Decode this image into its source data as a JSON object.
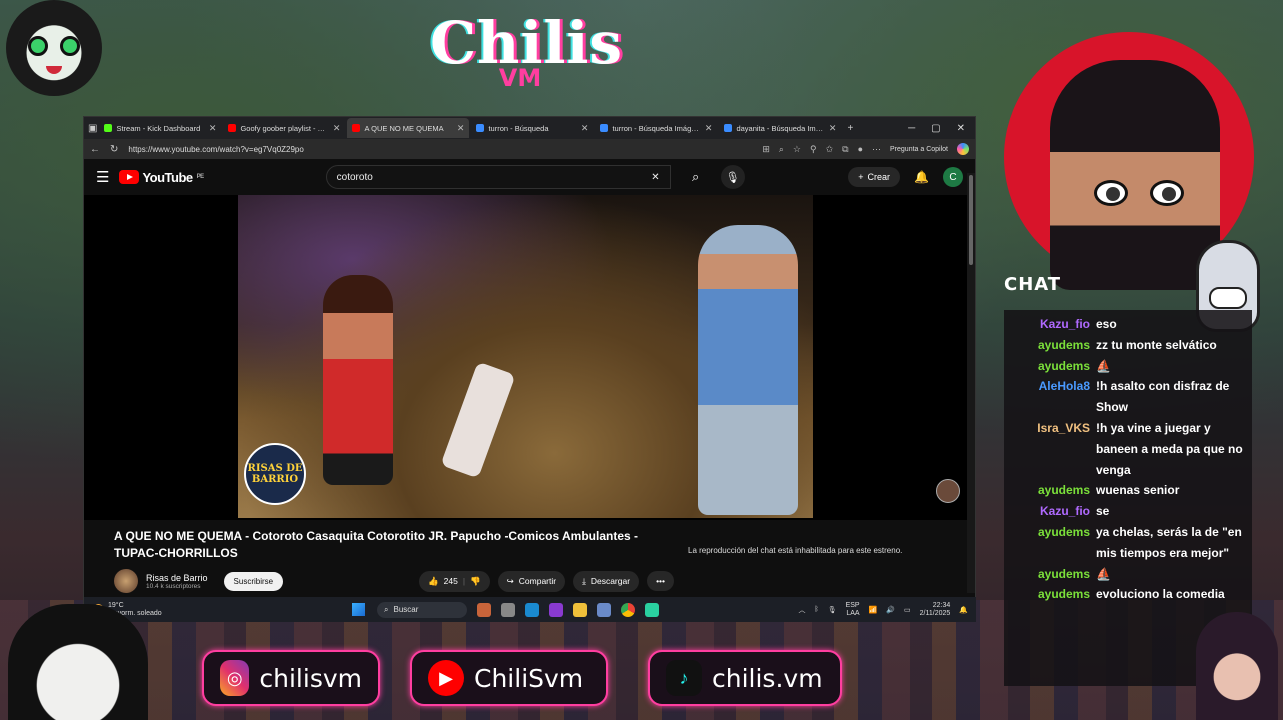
{
  "overlay": {
    "logo_main": "Chilis",
    "logo_sub": "VM",
    "chat_label": "CHAT",
    "channel_watermark": "RISAS DE BARRIO"
  },
  "browser": {
    "tabs": [
      {
        "label": "Stream - Kick Dashboard",
        "icon": "kick-icon",
        "color": "#53fc18",
        "active": false
      },
      {
        "label": "Goofy goober playlist - You",
        "icon": "youtube-icon",
        "color": "#ff0000",
        "active": false
      },
      {
        "label": "A QUE NO ME QUEMA",
        "icon": "youtube-icon",
        "color": "#ff0000",
        "active": true
      },
      {
        "label": "turron - Búsqueda",
        "icon": "search-icon",
        "color": "#3a8cff",
        "active": false
      },
      {
        "label": "turron - Búsqueda Imágenes",
        "icon": "search-icon",
        "color": "#3a8cff",
        "active": false
      },
      {
        "label": "dayanita - Búsqueda Imáge",
        "icon": "search-icon",
        "color": "#3a8cff",
        "active": false
      }
    ],
    "url": "https://www.youtube.com/watch?v=eg7Vq0Z29po",
    "copilot_label": "Pregunta a Copilot"
  },
  "youtube": {
    "logo_text": "YouTube",
    "region": "PE",
    "search_value": "cotoroto",
    "create_label": "Crear",
    "avatar_letter": "C",
    "video_title": "A QUE NO ME QUEMA - Cotoroto Casaquita Cotorotito JR. Papucho -Comicos Ambulantes - TUPAC-CHORRILLOS",
    "channel_name": "Risas de Barrio",
    "subscribers": "10.4 k suscriptores",
    "subscribe_label": "Suscribirse",
    "likes": "245",
    "share_label": "Compartir",
    "download_label": "Descargar",
    "chat_disabled": "La reproducción del chat está inhabilitada para este estreno."
  },
  "taskbar": {
    "temp": "19°C",
    "weather": "Mayorm. soleado",
    "search_placeholder": "Buscar",
    "lang": "ESP",
    "lang2": "LAA",
    "time": "22:34",
    "date": "2/11/2025"
  },
  "chat": [
    {
      "user": "Kazu_fio",
      "color": "#b06aff",
      "text": "eso"
    },
    {
      "user": "ayudems",
      "color": "#7be03a",
      "text": "zz tu monte selvático"
    },
    {
      "user": "ayudems",
      "color": "#7be03a",
      "text": "⛵"
    },
    {
      "user": "AleHola8",
      "color": "#4a9aff",
      "text": "!h asalto con disfraz de Show"
    },
    {
      "user": "Isra_VKS",
      "color": "#f0c080",
      "text": "!h ya vine a juegar y baneen a meda pa que no venga"
    },
    {
      "user": "ayudems",
      "color": "#7be03a",
      "text": "wuenas senior"
    },
    {
      "user": "Kazu_fio",
      "color": "#b06aff",
      "text": "se"
    },
    {
      "user": "ayudems",
      "color": "#7be03a",
      "text": "ya chelas, serás la de \"en mis tiempos era mejor\""
    },
    {
      "user": "ayudems",
      "color": "#7be03a",
      "text": "⛵"
    },
    {
      "user": "ayudems",
      "color": "#7be03a",
      "text": "evoluciono la comedia"
    }
  ],
  "socials": [
    {
      "handle": "chilisvm",
      "icon": "instagram-icon",
      "color": "#e1306c"
    },
    {
      "handle": "ChiliSvm",
      "icon": "youtube-icon",
      "color": "#ff0000"
    },
    {
      "handle": "chilis.vm",
      "icon": "tiktok-icon",
      "color": "#25f4ee"
    }
  ]
}
